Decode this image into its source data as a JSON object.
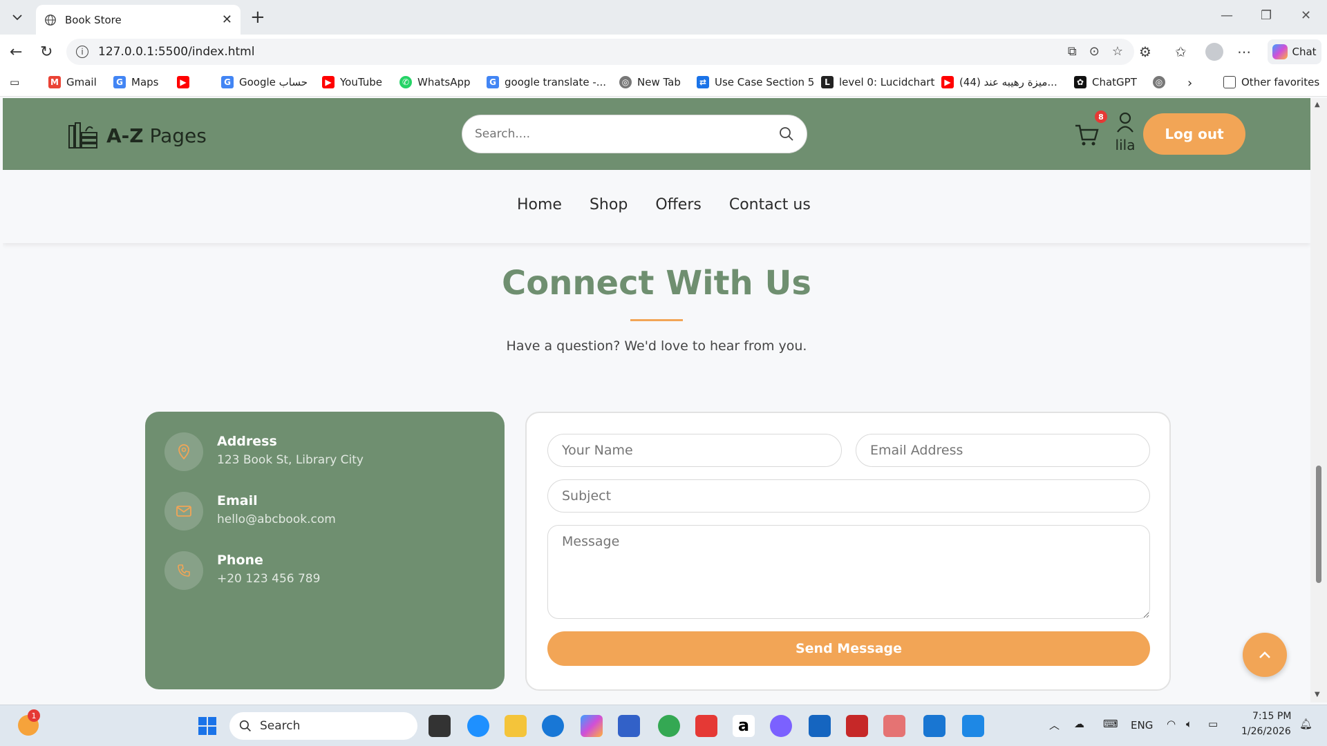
{
  "browser": {
    "tab_title": "Book Store",
    "url": "127.0.0.1:5500/index.html",
    "chat_label": "Chat",
    "bookmarks": [
      {
        "label": "Gmail",
        "icon": "gmail-icon",
        "color": "#ea4335"
      },
      {
        "label": "Maps",
        "icon": "google-icon",
        "color": "#4285f4"
      },
      {
        "label": "",
        "icon": "youtube-icon",
        "color": "#ff0000"
      },
      {
        "label": "Google حساب",
        "icon": "google-icon",
        "color": "#4285f4"
      },
      {
        "label": "YouTube",
        "icon": "youtube-icon",
        "color": "#ff0000"
      },
      {
        "label": "WhatsApp",
        "icon": "whatsapp-icon",
        "color": "#25d366"
      },
      {
        "label": "google translate -...",
        "icon": "google-icon",
        "color": "#4285f4"
      },
      {
        "label": "New Tab",
        "icon": "globe-icon",
        "color": "#555555"
      },
      {
        "label": "Use Case Section 5",
        "icon": "bookmark-app-icon",
        "color": "#1a73e8"
      },
      {
        "label": "level 0: Lucidchart",
        "icon": "lucidchart-icon",
        "color": "#222222"
      },
      {
        "label": "",
        "icon": "youtube-icon",
        "color": "#ff0000"
      },
      {
        "label": "(44) ميزة رهيبه عند...",
        "icon": "",
        "color": "#ff0000"
      },
      {
        "label": "ChatGPT",
        "icon": "chatgpt-icon",
        "color": "#111111"
      },
      {
        "label": "",
        "icon": "globe-icon",
        "color": "#555555"
      }
    ],
    "other_favorites": "Other favorites"
  },
  "site": {
    "logo_bold": "A-Z",
    "logo_rest": " Pages",
    "search_placeholder": "Search....",
    "cart_count": "8",
    "user_name": "lila",
    "logout_label": "Log out",
    "nav": [
      "Home",
      "Shop",
      "Offers",
      "Contact us"
    ]
  },
  "contact": {
    "heading": "Connect With Us",
    "subtext": "Have a question? We'd love to hear from you.",
    "info": [
      {
        "title": "Address",
        "value": "123 Book St, Library City",
        "icon": "location-pin-icon"
      },
      {
        "title": "Email",
        "value": "hello@abcbook.com",
        "icon": "mail-icon"
      },
      {
        "title": "Phone",
        "value": "+20 123 456 789",
        "icon": "phone-icon"
      }
    ],
    "form": {
      "name_placeholder": "Your Name",
      "email_placeholder": "Email Address",
      "subject_placeholder": "Subject",
      "message_placeholder": "Message",
      "send_label": "Send Message"
    }
  },
  "taskbar": {
    "search_label": "Search",
    "notification_count": "1",
    "language": "ENG",
    "time": "7:15 PM",
    "date": "1/26/2026"
  },
  "colors": {
    "header_green": "#6f8f70",
    "accent_orange": "#f2a556",
    "badge_red": "#e53935"
  }
}
